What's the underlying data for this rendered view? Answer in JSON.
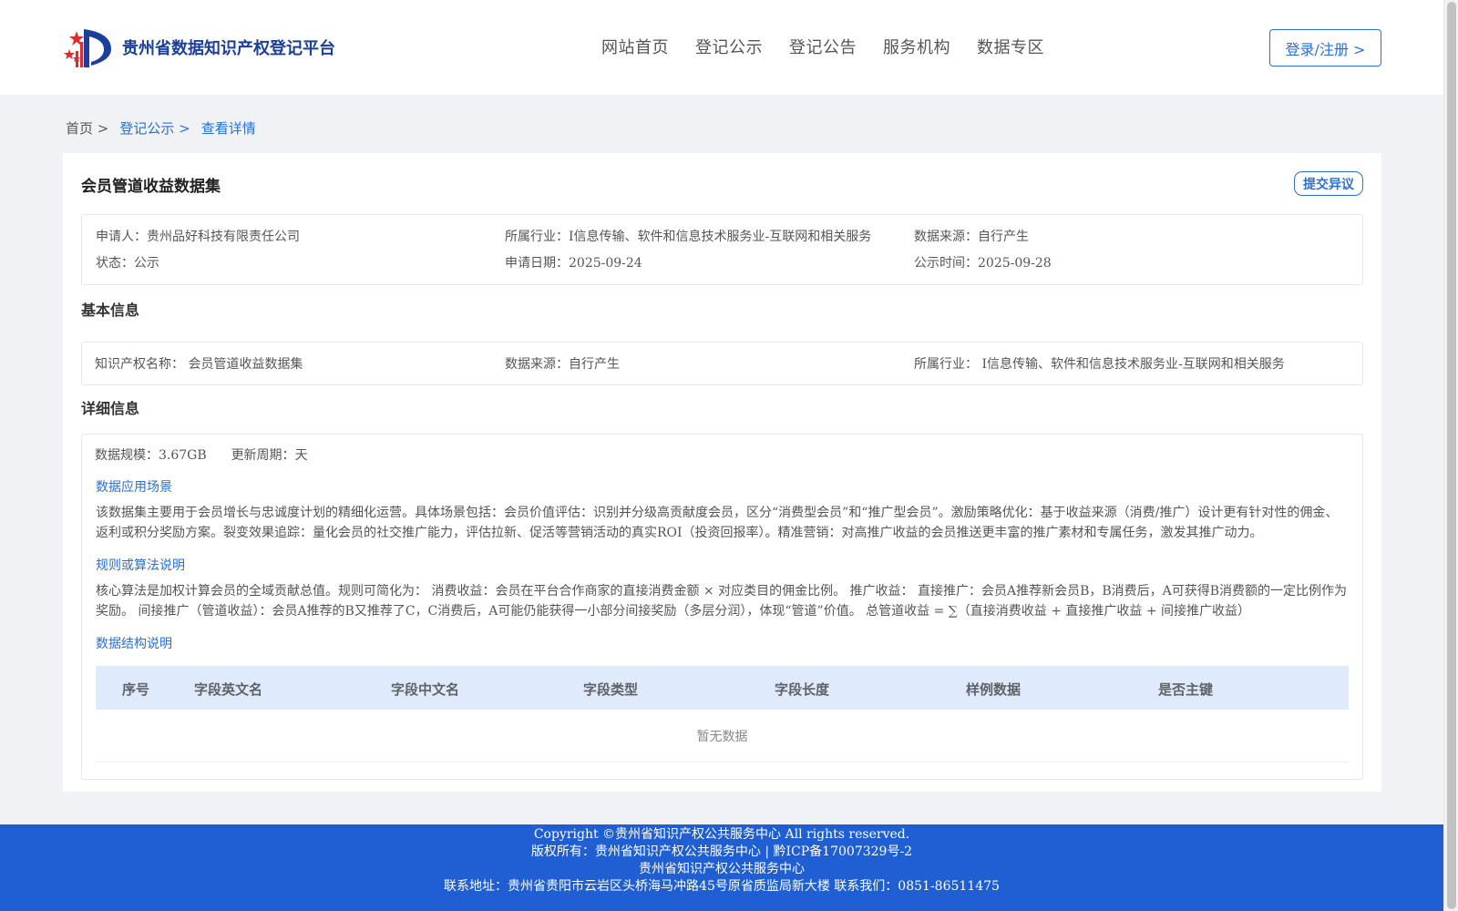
{
  "header": {
    "site_title": "贵州省数据知识产权登记平台",
    "nav": [
      "网站首页",
      "登记公示",
      "登记公告",
      "服务机构",
      "数据专区"
    ],
    "login_label": "登录/注册 >"
  },
  "breadcrumb": [
    "首页 >",
    "登记公示 >",
    "查看详情"
  ],
  "record": {
    "title": "会员管道收益数据集",
    "objection_label": "提交异议",
    "summary": {
      "applicant_label": "申请人：",
      "applicant": "贵州品好科技有限责任公司",
      "industry_label": "所属行业：",
      "industry": "I信息传输、软件和信息技术服务业-互联网和相关服务",
      "source_label": "数据来源：",
      "source": "自行产生",
      "status_label": "状态：",
      "status": "公示",
      "apply_date_label": "申请日期：",
      "apply_date": "2025-09-24",
      "publicity_time_label": "公示时间：",
      "publicity_time": "2025-09-28"
    }
  },
  "basic_info": {
    "section_title": "基本信息",
    "ip_name_label": "知识产权名称：",
    "ip_name": "会员管道收益数据集",
    "source_label": "数据来源：",
    "source": "自行产生",
    "industry_label": "所属行业：",
    "industry": "I信息传输、软件和信息技术服务业-互联网和相关服务"
  },
  "detail_info": {
    "section_title": "详细信息",
    "scale_label": "数据规模：",
    "scale": "3.67GB",
    "cycle_label": "更新周期：",
    "cycle": "天",
    "scenario_title": "数据应用场景",
    "scenario_text": "该数据集主要用于会员增长与忠诚度计划的精细化运营。具体场景包括：会员价值评估：识别并分级高贡献度会员，区分“消费型会员”和“推广型会员”。激励策略优化：基于收益来源（消费/推广）设计更有针对性的佣金、返利或积分奖励方案。裂变效果追踪：量化会员的社交推广能力，评估拉新、促活等营销活动的真实ROI（投资回报率）。精准营销：对高推广收益的会员推送更丰富的推广素材和专属任务，激发其推广动力。",
    "rule_title": "规则或算法说明",
    "rule_text": "核心算法是加权计算会员的全域贡献总值。规则可简化为： 消费收益：会员在平台合作商家的直接消费金额 × 对应类目的佣金比例。 推广收益： 直接推广：会员A推荐新会员B，B消费后，A可获得B消费额的一定比例作为奖励。 间接推广（管道收益）：会员A推荐的B又推荐了C，C消费后，A可能仍能获得一小部分间接奖励（多层分润），体现“管道”价值。 总管道收益 = ∑（直接消费收益 + 直接推广收益 + 间接推广收益）",
    "structure_title": "数据结构说明",
    "table_headers": [
      "序号",
      "字段英文名",
      "字段中文名",
      "字段类型",
      "字段长度",
      "样例数据",
      "是否主键"
    ],
    "empty_text": "暂无数据"
  },
  "footer": {
    "copyright": "Copyright ©贵州省知识产权公共服务中心 All rights reserved.",
    "ownership": "版权所有：贵州省知识产权公共服务中心 | 黔ICP备17007329号-2",
    "org": "贵州省知识产权公共服务中心",
    "contact": "联系地址：贵州省贵阳市云岩区头桥海马冲路45号原省质监局新大楼 联系我们：0851-86511475"
  }
}
